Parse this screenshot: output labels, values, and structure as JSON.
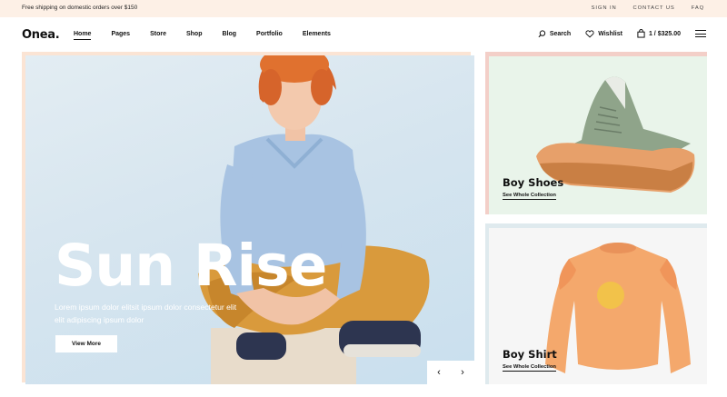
{
  "topbar": {
    "shipping_text": "Free shipping on domestic orders over $150",
    "links": [
      "SIGN IN",
      "CONTACT US",
      "FAQ"
    ]
  },
  "header": {
    "logo": "Onea.",
    "nav": [
      "Home",
      "Pages",
      "Store",
      "Shop",
      "Blog",
      "Portfolio",
      "Elements"
    ],
    "active_nav": "Home",
    "search_label": "Search",
    "wishlist_label": "Wishlist",
    "cart_label": "1 / $325.00"
  },
  "hero": {
    "title": "Sun Rise",
    "text_line1": "Lorem ipsum dolor elitsit ipsum dolor consectetur elit",
    "text_line2": "elit adipiscing ipsum dolor",
    "button_label": "View More",
    "prev_arrow": "‹",
    "next_arrow": "›"
  },
  "cards": [
    {
      "title": "Boy Shoes",
      "link": "See Whole Collection"
    },
    {
      "title": "Boy Shirt",
      "link": "See Whole Collection"
    }
  ],
  "colors": {
    "topbar_bg": "#fdf0e6",
    "hero_bg": "#d6e5ef",
    "card1_bg": "#e9f4ea",
    "card1_border": "#f3cfc8",
    "card2_bg": "#f6f6f6",
    "card2_border": "#dfeaee"
  }
}
